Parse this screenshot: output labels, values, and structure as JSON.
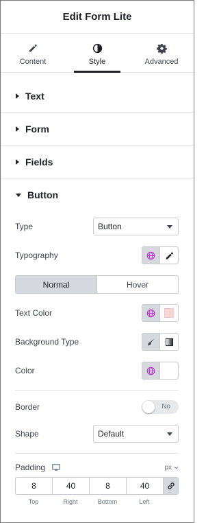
{
  "header": {
    "title": "Edit Form Lite"
  },
  "tabs": [
    {
      "label": "Content",
      "icon": "pencil-icon"
    },
    {
      "label": "Style",
      "icon": "contrast-icon"
    },
    {
      "label": "Advanced",
      "icon": "gear-icon"
    }
  ],
  "active_tab": "Style",
  "sections": [
    {
      "label": "Text"
    },
    {
      "label": "Form"
    },
    {
      "label": "Fields"
    },
    {
      "label": "Button"
    }
  ],
  "button_section": {
    "type": {
      "label": "Type",
      "value": "Button"
    },
    "typography": {
      "label": "Typography"
    },
    "state_tabs": {
      "normal": "Normal",
      "hover": "Hover",
      "active": "Normal"
    },
    "text_color": {
      "label": "Text Color",
      "swatch": "#f8d7d7"
    },
    "background_type": {
      "label": "Background Type"
    },
    "color": {
      "label": "Color"
    },
    "border": {
      "label": "Border",
      "toggle": "No"
    },
    "shape": {
      "label": "Shape",
      "value": "Default"
    },
    "padding": {
      "label": "Padding",
      "unit": "px",
      "values": [
        {
          "value": "8",
          "label": "Top"
        },
        {
          "value": "40",
          "label": "Right"
        },
        {
          "value": "8",
          "label": "Bottom"
        },
        {
          "value": "40",
          "label": "Left"
        }
      ]
    }
  },
  "colors": {
    "accent_globe": "#c036d6",
    "text": "#1f2124"
  }
}
